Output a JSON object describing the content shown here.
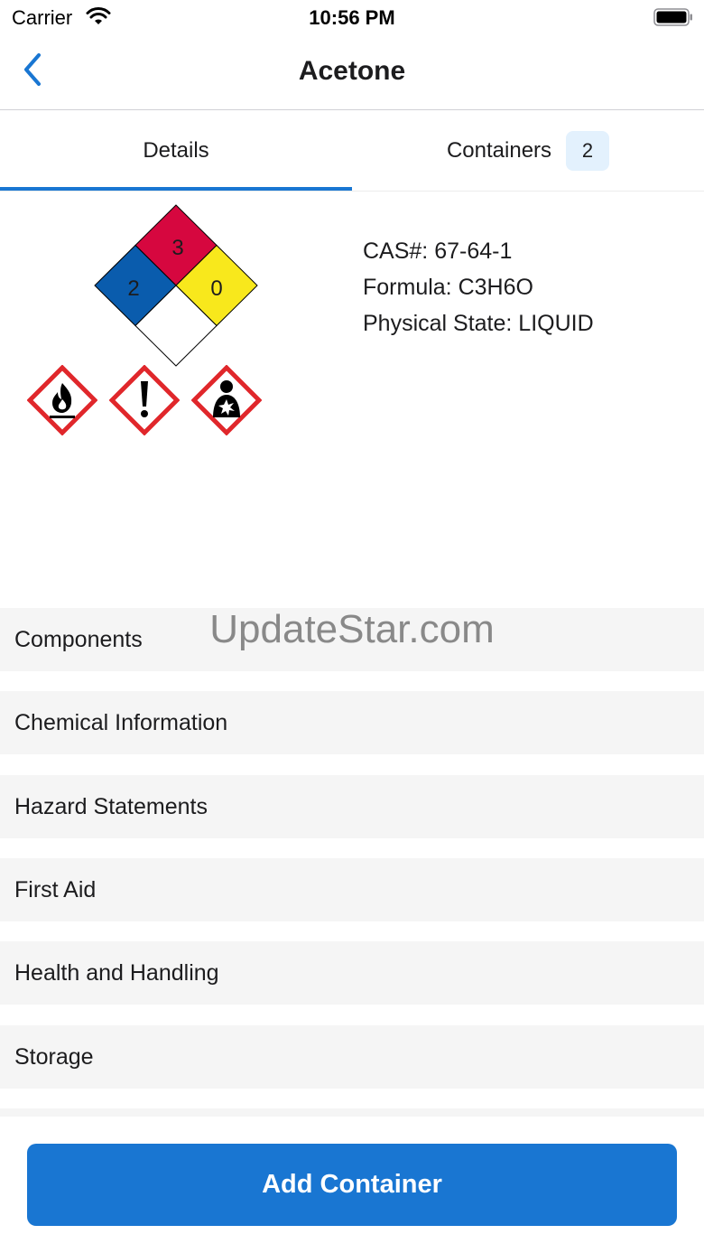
{
  "status_bar": {
    "carrier": "Carrier",
    "time": "10:56 PM",
    "wifi_icon": "wifi-icon",
    "battery_icon": "battery-icon"
  },
  "nav": {
    "back_icon": "chevron-left-icon",
    "title": "Acetone"
  },
  "tabs": [
    {
      "label": "Details",
      "selected": true
    },
    {
      "label": "Containers",
      "badge": "2",
      "selected": false
    }
  ],
  "nfpa_diamond": {
    "health": "2",
    "flammability": "3",
    "instability": "0",
    "special": "",
    "colors": {
      "health": "#0a5cad",
      "flammability": "#d6073f",
      "instability": "#f8e81c",
      "special": "#ffffff"
    }
  },
  "ghs_pictograms": [
    "flame-icon",
    "exclamation-mark-icon",
    "health-hazard-icon"
  ],
  "chemical": {
    "cas": "CAS#: 67-64-1",
    "formula": "Formula: C3H6O",
    "physical_state": "Physical State: LIQUID"
  },
  "watermark": "UpdateStar.com",
  "sections": [
    {
      "label": "Components"
    },
    {
      "label": "Chemical Information"
    },
    {
      "label": "Hazard Statements"
    },
    {
      "label": "First Aid"
    },
    {
      "label": "Health and Handling"
    },
    {
      "label": "Storage"
    }
  ],
  "actions": {
    "add_container": "Add Container"
  },
  "colors": {
    "accent": "#1976d2",
    "badge_bg": "#e3f1fd",
    "section_bg": "#f5f5f5",
    "ghs_red": "#e0272b"
  }
}
